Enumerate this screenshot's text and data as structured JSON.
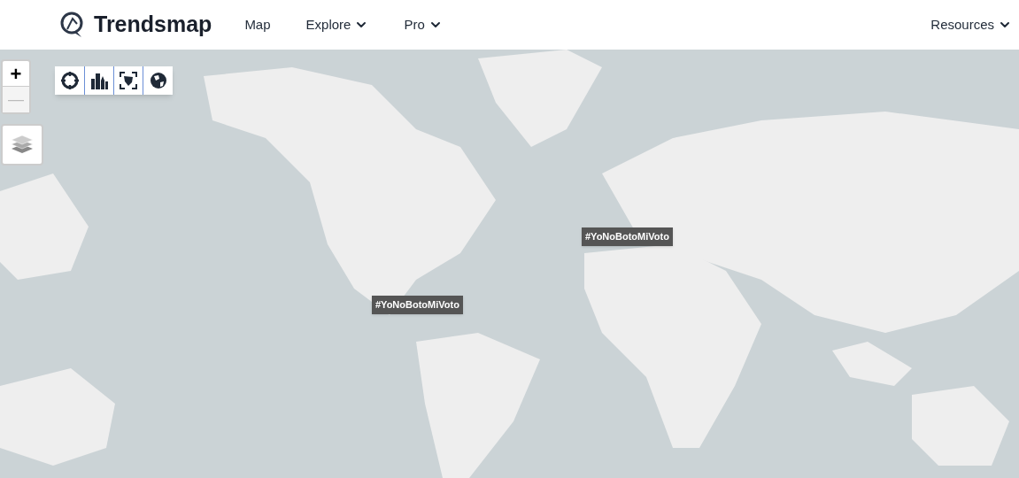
{
  "header": {
    "brand": "Trendsmap",
    "nav": [
      {
        "label": "Map",
        "dropdown": false
      },
      {
        "label": "Explore",
        "dropdown": true
      },
      {
        "label": "Pro",
        "dropdown": true
      }
    ],
    "right_nav": [
      {
        "label": "Resources",
        "dropdown": true
      }
    ]
  },
  "map": {
    "zoom_in": {
      "label": "+",
      "disabled": false
    },
    "zoom_out": {
      "label": "—",
      "disabled": true
    },
    "trends": [
      {
        "label": "#YoNoBotoMiVoto"
      },
      {
        "label": "#YoNoBotoMiVoto"
      }
    ]
  }
}
